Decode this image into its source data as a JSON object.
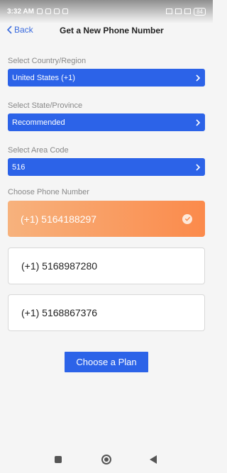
{
  "status_bar": {
    "time": "3:32 AM",
    "battery": "84"
  },
  "header": {
    "back_label": "Back",
    "title": "Get a New Phone Number"
  },
  "country": {
    "label": "Select Country/Region",
    "value": "United States (+1)"
  },
  "state": {
    "label": "Select State/Province",
    "value": "Recommended"
  },
  "area": {
    "label": "Select Area Code",
    "value": "516"
  },
  "numbers": {
    "label": "Choose Phone Number",
    "items": [
      {
        "number": "(+1) 5164188297",
        "selected": true
      },
      {
        "number": "(+1) 5168987280",
        "selected": false
      },
      {
        "number": "(+1) 5168867376",
        "selected": false
      }
    ]
  },
  "actions": {
    "plan_label": "Choose a Plan"
  },
  "colors": {
    "primary": "#2c63e8",
    "accent_start": "#f7b27d",
    "accent_end": "#fb8a4b",
    "link": "#3a6bde"
  }
}
